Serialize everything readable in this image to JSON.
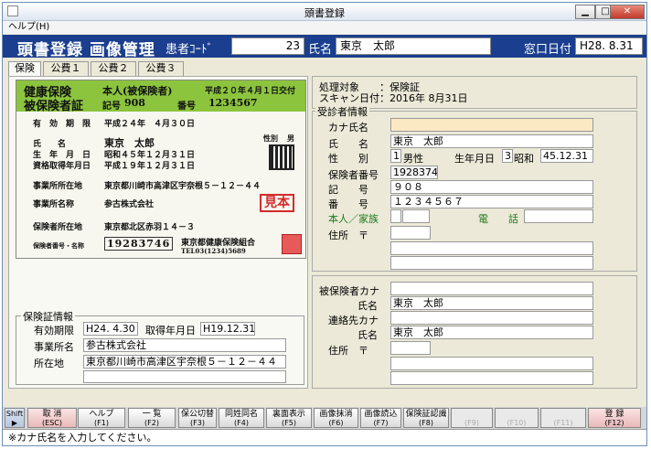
{
  "window": {
    "title": "頭書登録"
  },
  "menu": {
    "help": "ヘルプ(H)"
  },
  "header": {
    "title": "頭書登録 画像管理",
    "patient_code_label": "患者ｺｰﾄﾞ",
    "patient_code": "23",
    "name_label": "氏名",
    "name": "東京　太郎",
    "reception_date_label": "窓口日付",
    "reception_date": "H28. 8.31"
  },
  "tabs": [
    "保険",
    "公費１",
    "公費２",
    "公費３"
  ],
  "card": {
    "title1": "健康保険",
    "title2": "被保険者証",
    "holder": "本人(被保険者)",
    "issued": "平成２０年４月１日交付",
    "symbol_label": "記号",
    "symbol": "908",
    "number_label": "番号",
    "number": "1234567",
    "validity_label": "有　効　期　限",
    "validity": "平成２４年　４月３０日",
    "name_label": "氏　　名",
    "name": "東京　太郎",
    "gender_label": "性別",
    "gender": "男",
    "birth_label": "生　年　月　日",
    "birth": "昭和４５年１２月３１日",
    "qualify_label": "資格取得年月日",
    "qualify": "平成１９年１２月３１日",
    "addr_label": "事業所所在地",
    "addr": "東京都川崎市高津区宇奈根５－１２－４４",
    "company_label": "事業所名称",
    "company": "参古株式会社",
    "insurer_addr_label": "保険者所在地",
    "insurer_addr": "東京都北区赤羽１４－３",
    "insurer_label": "保険者番号・名称",
    "insurer_no": "19283746",
    "insurer_name": "東京都健康保険組合",
    "insurer_tel": "TEL03(1234)5689",
    "stamp": "見本"
  },
  "insurance_info": {
    "legend": "保険証情報",
    "validity_label": "有効期限",
    "validity": "H24. 4.30",
    "acquired_label": "取得年月日",
    "acquired": "H19.12.31",
    "office_label": "事業所名",
    "office": "参古株式会社",
    "address_label": "所在地",
    "address": "東京都川崎市高津区宇奈根５－１２－４４"
  },
  "process": {
    "target_label": "処理対象",
    "target": "：保険証",
    "scan_label": "スキャン日付",
    "scan": "：2016年 8月31日"
  },
  "patient": {
    "legend": "受診者情報",
    "kana_label": "カナ氏名",
    "kana": "",
    "name_label": "氏　　名",
    "name": "東京　太郎",
    "gender_label": "性　　別",
    "gender_code": "1",
    "gender": "男性",
    "birth_label": "生年月日",
    "era_code": "3",
    "era": "昭和",
    "birth": "45.12.31",
    "insured_no_label": "保険者番号",
    "insured_no": "19283746",
    "symbol_label": "記　　号",
    "symbol": "９０８",
    "number_label": "番　　号",
    "number": "１２３４５６７",
    "relation_label": "本人／家族",
    "phone_label": "電　　話",
    "address_label": "住所　〒"
  },
  "insured": {
    "kana_label": "被保険者カナ",
    "name_label": "氏名",
    "name": "東京　太郎",
    "contact_kana_label": "連絡先カナ",
    "contact_name_label": "氏名",
    "contact_name": "東京　太郎",
    "address_label": "住所　〒"
  },
  "shift": "Shift",
  "fkeys": [
    {
      "label": "取 消",
      "key": "(ESC)"
    },
    {
      "label": "ヘルプ",
      "key": "(F1)"
    },
    {
      "label": "一 覧",
      "key": "(F2)"
    },
    {
      "label": "保公切替",
      "key": "(F3)"
    },
    {
      "label": "同姓同名",
      "key": "(F4)"
    },
    {
      "label": "裏面表示",
      "key": "(F5)"
    },
    {
      "label": "画像抹消",
      "key": "(F6)"
    },
    {
      "label": "画像読込",
      "key": "(F7)"
    },
    {
      "label": "保険証認識",
      "key": "(F8)"
    },
    {
      "label": "",
      "key": "(F9)"
    },
    {
      "label": "",
      "key": "(F10)"
    },
    {
      "label": "",
      "key": "(F11)"
    },
    {
      "label": "登 録",
      "key": "(F12)"
    }
  ],
  "status": "※カナ氏名を入力してください。",
  "colors": {
    "header": "#1b3f8e",
    "card_head": "#8cc43e",
    "kana_field": "#fbe9c4",
    "stamp": "#d42a2a"
  }
}
